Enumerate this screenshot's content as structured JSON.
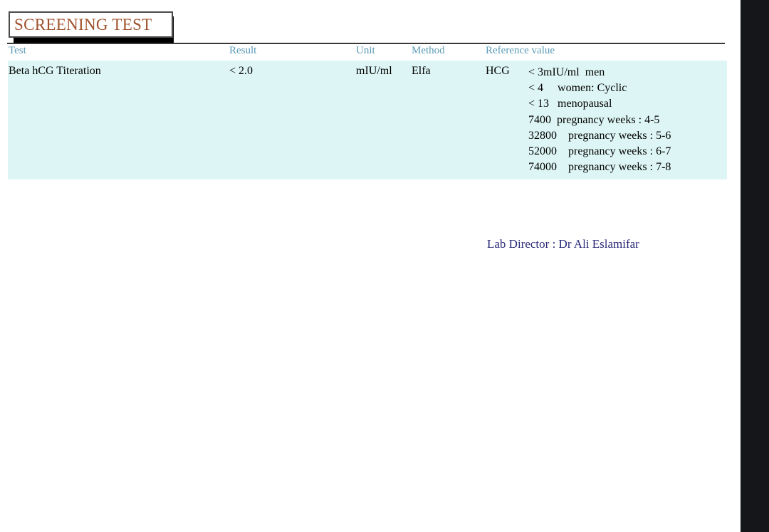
{
  "document": {
    "title": "SCREENING TEST"
  },
  "table": {
    "headers": {
      "test": "Test",
      "result": "Result",
      "unit": "Unit",
      "method": "Method",
      "reference": "Reference value"
    },
    "rows": [
      {
        "test": "Beta hCG Titeration",
        "result": "<  2.0",
        "unit": "mIU/ml",
        "method": "Elfa",
        "reference_label": "HCG",
        "reference_lines": [
          "< 3mIU/ml  men",
          "< 4     women: Cyclic",
          "< 13   menopausal",
          "7400  pregnancy weeks : 4-5",
          "32800    pregnancy weeks : 5-6",
          "52000    pregnancy weeks : 6-7",
          "74000    pregnancy weeks : 7-8"
        ]
      }
    ]
  },
  "footer": {
    "signature": "Lab Director : Dr Ali Eslamifar"
  },
  "colors": {
    "title_text": "#a0522d",
    "header_text": "#5b9bb5",
    "row_background": "#ddf6f5",
    "signature_text": "#2b2b7a",
    "right_band": "#141619",
    "rule": "#3a3a3a"
  }
}
